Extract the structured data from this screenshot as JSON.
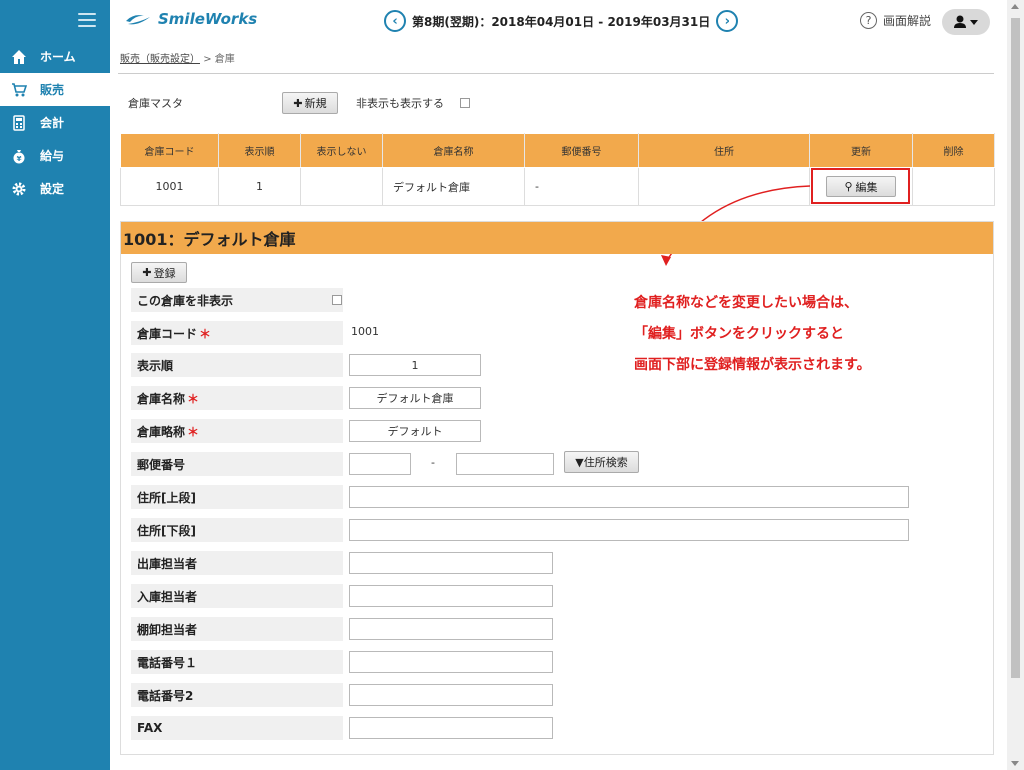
{
  "app": {
    "logo_text": "SmileWorks"
  },
  "header": {
    "period": "第8期(翌期)：2018年04月01日 - 2019年03月31日",
    "prev_icon": "chevron-left-icon",
    "next_icon": "chevron-right-icon",
    "help_label": "画面解説"
  },
  "sidebar": {
    "items": [
      {
        "label": "ホーム",
        "icon": "home-icon"
      },
      {
        "label": "販売",
        "icon": "cart-icon"
      },
      {
        "label": "会計",
        "icon": "calculator-icon"
      },
      {
        "label": "給与",
        "icon": "money-bag-icon"
      },
      {
        "label": "設定",
        "icon": "gear-icon"
      }
    ],
    "active": "販売"
  },
  "breadcrumb": {
    "parent": "販売（販売設定）",
    "separator": ">",
    "current": "倉庫"
  },
  "master": {
    "title": "倉庫マスタ",
    "new_button": "新規",
    "show_hidden_label": "非表示も表示する"
  },
  "table": {
    "headers": [
      "倉庫コード",
      "表示順",
      "表示しない",
      "倉庫名称",
      "郵便番号",
      "住所",
      "更新",
      "削除"
    ],
    "rows": [
      {
        "code": "1001",
        "order": "1",
        "hidden": "",
        "name": "デフォルト倉庫",
        "zip": "-",
        "address": "",
        "edit_label": "編集",
        "delete": ""
      }
    ]
  },
  "detail": {
    "title": "1001：デフォルト倉庫",
    "register_button": "登録",
    "fields": {
      "hide": "この倉庫を非表示",
      "code": "倉庫コード",
      "code_value": "1001",
      "order": "表示順",
      "order_value": "1",
      "name": "倉庫名称",
      "name_value": "デフォルト倉庫",
      "short_name": "倉庫略称",
      "short_name_value": "デフォルト",
      "zip": "郵便番号",
      "zip_dash": "-",
      "zip_search_button": "▼住所検索",
      "address1": "住所[上段]",
      "address2": "住所[下段]",
      "out_person": "出庫担当者",
      "in_person": "入庫担当者",
      "inventory_person": "棚卸担当者",
      "phone1": "電話番号１",
      "phone2": "電話番号2",
      "fax": "FAX"
    },
    "required_mark": "＊"
  },
  "annotation": {
    "lines": [
      "倉庫名称などを変更したい場合は、",
      "「編集」ボタンをクリックすると",
      "画面下部に登録情報が表示されます。"
    ],
    "color": "#e02020"
  },
  "colors": {
    "sidebar": "#1f82b0",
    "header_orange": "#f2a94c",
    "accent_red": "#e02020"
  }
}
